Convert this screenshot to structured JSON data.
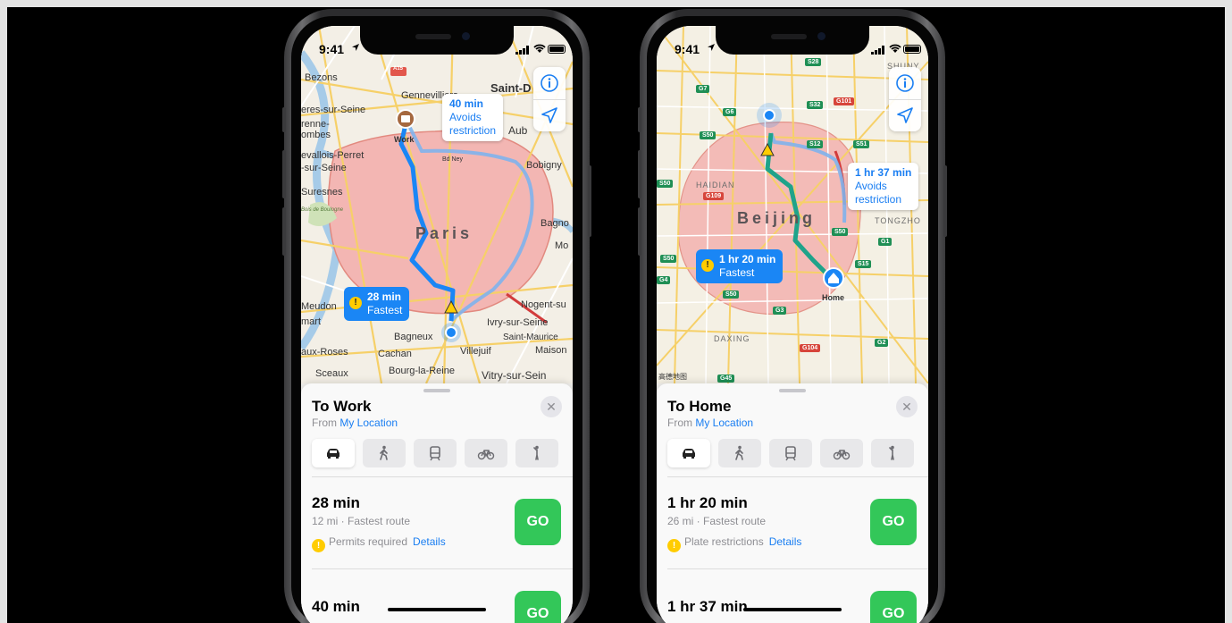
{
  "status": {
    "time": "9:41"
  },
  "phones": [
    {
      "map": {
        "city": "Paris",
        "labels": [
          "Bezons",
          "Gennevilliers",
          "Saint-D",
          "eres-sur-Seine",
          "renne-",
          "ombes",
          "Aub",
          "Bobigny",
          "evallois-Perret",
          "-sur-Seine",
          "Bd Ney",
          "Suresnes",
          "Bois de Boulogne",
          "Bagno",
          "Mo",
          "Meudon",
          "mart",
          "Nogent-su",
          "Ivry-sur-Seine",
          "Bagneux",
          "Saint-Maurice",
          "aux-Roses",
          "Cachan",
          "Villejuif",
          "Maison",
          "Sceaux",
          "Bourg-la-Reine",
          "Vitry-sur-Sein",
          "A15"
        ],
        "pin_label": "Work",
        "callout_alt": {
          "duration": "40 min",
          "line1": "Avoids",
          "line2": "restriction"
        },
        "callout_main": {
          "duration": "28 min",
          "sub": "Fastest"
        }
      },
      "card": {
        "title": "To Work",
        "from_prefix": "From",
        "from_link": "My Location",
        "close": "✕",
        "routes": [
          {
            "duration": "28 min",
            "info": "12 mi · Fastest route",
            "warning": "Permits required",
            "details": "Details",
            "go": "GO"
          },
          {
            "duration": "40 min",
            "go": "GO"
          }
        ]
      }
    },
    {
      "map": {
        "city": "Beijing",
        "labels": [
          "HAIDIAN",
          "TONGZHO",
          "DAXING",
          "SHUNY",
          "高德地图"
        ],
        "shields": [
          "S28",
          "G7",
          "G6",
          "S32",
          "G101",
          "S50",
          "S12",
          "S51",
          "S50",
          "G109",
          "G1",
          "S50",
          "S50",
          "G4",
          "S15",
          "G3",
          "S50",
          "G104",
          "G2",
          "G45"
        ],
        "pin_label": "Home",
        "callout_alt": {
          "duration": "1 hr 37 min",
          "line1": "Avoids",
          "line2": "restriction"
        },
        "callout_main": {
          "duration": "1 hr 20 min",
          "sub": "Fastest"
        }
      },
      "card": {
        "title": "To Home",
        "from_prefix": "From",
        "from_link": "My Location",
        "close": "✕",
        "routes": [
          {
            "duration": "1 hr 20 min",
            "info": "26 mi · Fastest route",
            "warning": "Plate restrictions",
            "details": "Details",
            "go": "GO"
          },
          {
            "duration": "1 hr 37 min",
            "go": "GO"
          }
        ]
      }
    }
  ],
  "transport_modes": [
    "car-icon",
    "walk-icon",
    "transit-icon",
    "bike-icon",
    "rideshare-icon"
  ],
  "colors": {
    "route": "#1a86f5",
    "route_beijing": "#1fa38a",
    "zone": "#f3b6b3",
    "go": "#33c759",
    "accent": "#1a7ef2"
  }
}
